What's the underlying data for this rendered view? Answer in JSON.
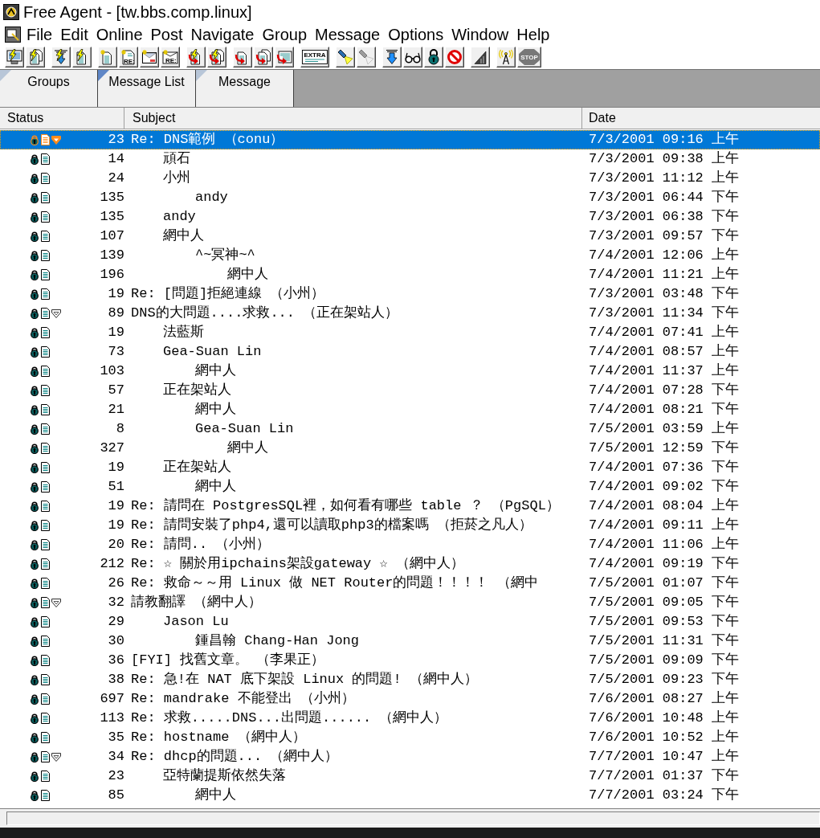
{
  "window": {
    "title": "Free Agent - [tw.bbs.comp.linux]"
  },
  "menu": [
    "File",
    "Edit",
    "Online",
    "Post",
    "Navigate",
    "Group",
    "Message",
    "Options",
    "Window",
    "Help"
  ],
  "toolbar": [
    {
      "buttons": [
        {
          "kind": "bolt-screen",
          "disabled": false
        },
        {
          "kind": "bolt-pages",
          "disabled": false
        }
      ]
    },
    {
      "buttons": [
        {
          "kind": "bolt-arrow",
          "disabled": false
        },
        {
          "kind": "bolt-page",
          "disabled": false
        }
      ]
    },
    {
      "buttons": [
        {
          "kind": "new-page",
          "disabled": false
        },
        {
          "kind": "new-reply",
          "label": "RE:",
          "disabled": false
        },
        {
          "kind": "new-mail",
          "disabled": false
        },
        {
          "kind": "mail-reply",
          "label": "RE:",
          "disabled": false
        }
      ]
    },
    {
      "buttons": [
        {
          "kind": "bolt-return-page",
          "disabled": false
        },
        {
          "kind": "bolt-return-pages",
          "disabled": false
        }
      ]
    },
    {
      "buttons": [
        {
          "kind": "return-page",
          "disabled": false
        },
        {
          "kind": "return-pages",
          "disabled": false
        },
        {
          "kind": "return-sheet",
          "disabled": false
        }
      ]
    },
    {
      "buttons": [
        {
          "kind": "label-sheet",
          "label": "EXTRA",
          "disabled": false
        }
      ]
    },
    {
      "buttons": [
        {
          "kind": "flashlight",
          "disabled": false
        },
        {
          "kind": "flashlight",
          "disabled": true
        }
      ]
    },
    {
      "buttons": [
        {
          "kind": "down-arrow",
          "disabled": false
        },
        {
          "kind": "glasses",
          "disabled": false
        },
        {
          "kind": "padlock",
          "disabled": false
        },
        {
          "kind": "prohibition",
          "disabled": false
        }
      ]
    },
    {
      "buttons": [
        {
          "kind": "ramp",
          "disabled": false
        }
      ]
    },
    {
      "buttons": [
        {
          "kind": "antenna",
          "disabled": false
        },
        {
          "kind": "stop",
          "label": "STOP",
          "disabled": true
        }
      ]
    }
  ],
  "tabs": [
    {
      "label": "Groups",
      "selected": false
    },
    {
      "label": "Message List",
      "selected": true
    },
    {
      "label": "Message",
      "selected": false
    }
  ],
  "columns": [
    "Status",
    "Subject",
    "Date"
  ],
  "messages": [
    {
      "lines": "23",
      "subject": "Re: DNS範例 （conu）",
      "date": "7/3/2001 09:16 上午",
      "selected": true,
      "expanded": true,
      "children": [
        {
          "lines": "14",
          "subject": "頑石",
          "date": "7/3/2001 09:38 上午",
          "selected": false
        },
        {
          "lines": "24",
          "subject": "小州",
          "date": "7/3/2001 11:12 上午",
          "selected": false,
          "children": [
            {
              "lines": "135",
              "subject": "andy",
              "date": "7/3/2001 06:44 下午",
              "selected": false
            }
          ]
        },
        {
          "lines": "135",
          "subject": "andy",
          "date": "7/3/2001 06:38 下午",
          "selected": false
        },
        {
          "lines": "107",
          "subject": "網中人",
          "date": "7/3/2001 09:57 下午",
          "selected": false,
          "children": [
            {
              "lines": "139",
              "subject": "^~冥神~^",
              "date": "7/4/2001 12:06 上午",
              "selected": false,
              "children": [
                {
                  "lines": "196",
                  "subject": "網中人",
                  "date": "7/4/2001 11:21 上午",
                  "selected": false
                }
              ]
            }
          ]
        }
      ]
    },
    {
      "lines": "19",
      "subject": "Re: [問題]拒絕連線 （小州）",
      "date": "7/3/2001 03:48 下午",
      "selected": false
    },
    {
      "lines": "89",
      "subject": "DNS的大問題....求救... （正在架站人）",
      "date": "7/3/2001 11:34 下午",
      "selected": false,
      "expanded": true,
      "children": [
        {
          "lines": "19",
          "subject": "法藍斯",
          "date": "7/4/2001 07:41 上午",
          "selected": false
        },
        {
          "lines": "73",
          "subject": "Gea-Suan Lin",
          "date": "7/4/2001 08:57 上午",
          "selected": false,
          "children": [
            {
              "lines": "103",
              "subject": "網中人",
              "date": "7/4/2001 11:37 上午",
              "selected": false
            }
          ]
        },
        {
          "lines": "57",
          "subject": "正在架站人",
          "date": "7/4/2001 07:28 下午",
          "selected": false,
          "children": [
            {
              "lines": "21",
              "subject": "網中人",
              "date": "7/4/2001 08:21 下午",
              "selected": false
            },
            {
              "lines": "8",
              "subject": "Gea-Suan Lin",
              "date": "7/5/2001 03:59 上午",
              "selected": false,
              "children": [
                {
                  "lines": "327",
                  "subject": "網中人",
                  "date": "7/5/2001 12:59 下午",
                  "selected": false
                }
              ]
            }
          ]
        },
        {
          "lines": "19",
          "subject": "正在架站人",
          "date": "7/4/2001 07:36 下午",
          "selected": false,
          "children": [
            {
              "lines": "51",
              "subject": "網中人",
              "date": "7/4/2001 09:02 下午",
              "selected": false
            }
          ]
        }
      ]
    },
    {
      "lines": "19",
      "subject": "Re: 請問在 PostgresSQL裡，如何看有哪些 table ？ （PgSQL）",
      "date": "7/4/2001 08:04 上午",
      "selected": false
    },
    {
      "lines": "19",
      "subject": "Re: 請問安裝了php4,還可以讀取php3的檔案嗎 （拒菸之凡人）",
      "date": "7/4/2001 09:11 上午",
      "selected": false
    },
    {
      "lines": "20",
      "subject": "Re: 請問.. （小州）",
      "date": "7/4/2001 11:06 上午",
      "selected": false
    },
    {
      "lines": "212",
      "subject": "Re: ☆ 關於用ipchains架設gateway ☆ （網中人）",
      "date": "7/4/2001 09:19 下午",
      "selected": false
    },
    {
      "lines": "26",
      "subject": "Re: 救命～～用 Linux 做 NET Router的問題！！！！ （網中",
      "date": "7/5/2001 01:07 下午",
      "selected": false
    },
    {
      "lines": "32",
      "subject": "請教翻譯 （網中人）",
      "date": "7/5/2001 09:05 下午",
      "selected": false,
      "expanded": true,
      "children": [
        {
          "lines": "29",
          "subject": "Jason Lu",
          "date": "7/5/2001 09:53 下午",
          "selected": false,
          "children": [
            {
              "lines": "30",
              "subject": "鍾昌翰 Chang-Han Jong",
              "date": "7/5/2001 11:31 下午",
              "selected": false
            }
          ]
        }
      ]
    },
    {
      "lines": "36",
      "subject": "[FYI] 找舊文章。 （李果正）",
      "date": "7/5/2001 09:09 下午",
      "selected": false
    },
    {
      "lines": "38",
      "subject": "Re: 急!在 NAT 底下架設 Linux 的問題! （網中人）",
      "date": "7/5/2001 09:23 下午",
      "selected": false
    },
    {
      "lines": "697",
      "subject": "Re: mandrake 不能登出 （小州）",
      "date": "7/6/2001 08:27 上午",
      "selected": false
    },
    {
      "lines": "113",
      "subject": "Re: 求救.....DNS...出問題...... （網中人）",
      "date": "7/6/2001 10:48 上午",
      "selected": false
    },
    {
      "lines": "35",
      "subject": "Re: hostname （網中人）",
      "date": "7/6/2001 10:52 上午",
      "selected": false
    },
    {
      "lines": "34",
      "subject": "Re: dhcp的問題... （網中人）",
      "date": "7/7/2001 10:47 上午",
      "selected": false,
      "expanded": true,
      "children": [
        {
          "lines": "23",
          "subject": "亞特蘭提斯依然失落",
          "date": "7/7/2001 01:37 下午",
          "selected": false,
          "children": [
            {
              "lines": "85",
              "subject": "網中人",
              "date": "7/7/2001 03:24 下午",
              "selected": false
            }
          ]
        }
      ]
    }
  ]
}
